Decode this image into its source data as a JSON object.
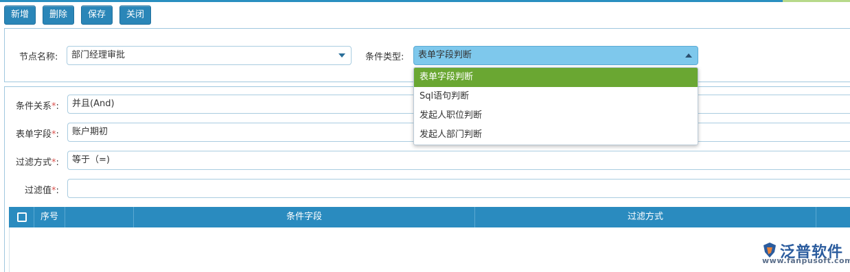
{
  "toolbar": {
    "add_label": "新增",
    "delete_label": "删除",
    "save_label": "保存",
    "close_label": "关闭"
  },
  "node_section": {
    "node_name_label": "节点名称:",
    "node_name_value": "部门经理审批",
    "condition_type_label": "条件类型:",
    "condition_type_value": "表单字段判断",
    "condition_type_options": [
      "表单字段判断",
      "Sql语句判断",
      "发起人职位判断",
      "发起人部门判断"
    ]
  },
  "condition_form": {
    "relation_label": "条件关系",
    "relation_value": "并且(And)",
    "form_field_label": "表单字段",
    "form_field_value": "账户期初",
    "filter_method_label": "过滤方式",
    "filter_method_value": "等于（=)",
    "filter_value_label": "过滤值",
    "filter_value_value": "",
    "required_mark": "*",
    "colon": ":"
  },
  "grid": {
    "columns": [
      "序号",
      "条件字段",
      "过滤方式"
    ]
  },
  "watermark": {
    "brand": "泛普软件",
    "url": "www.fanpusoft.com"
  },
  "colors": {
    "toolbar_button": "#2a86b8",
    "grid_header": "#2a8bbf",
    "selected_option": "#6aa732",
    "active_combo": "#7ec8ec"
  }
}
